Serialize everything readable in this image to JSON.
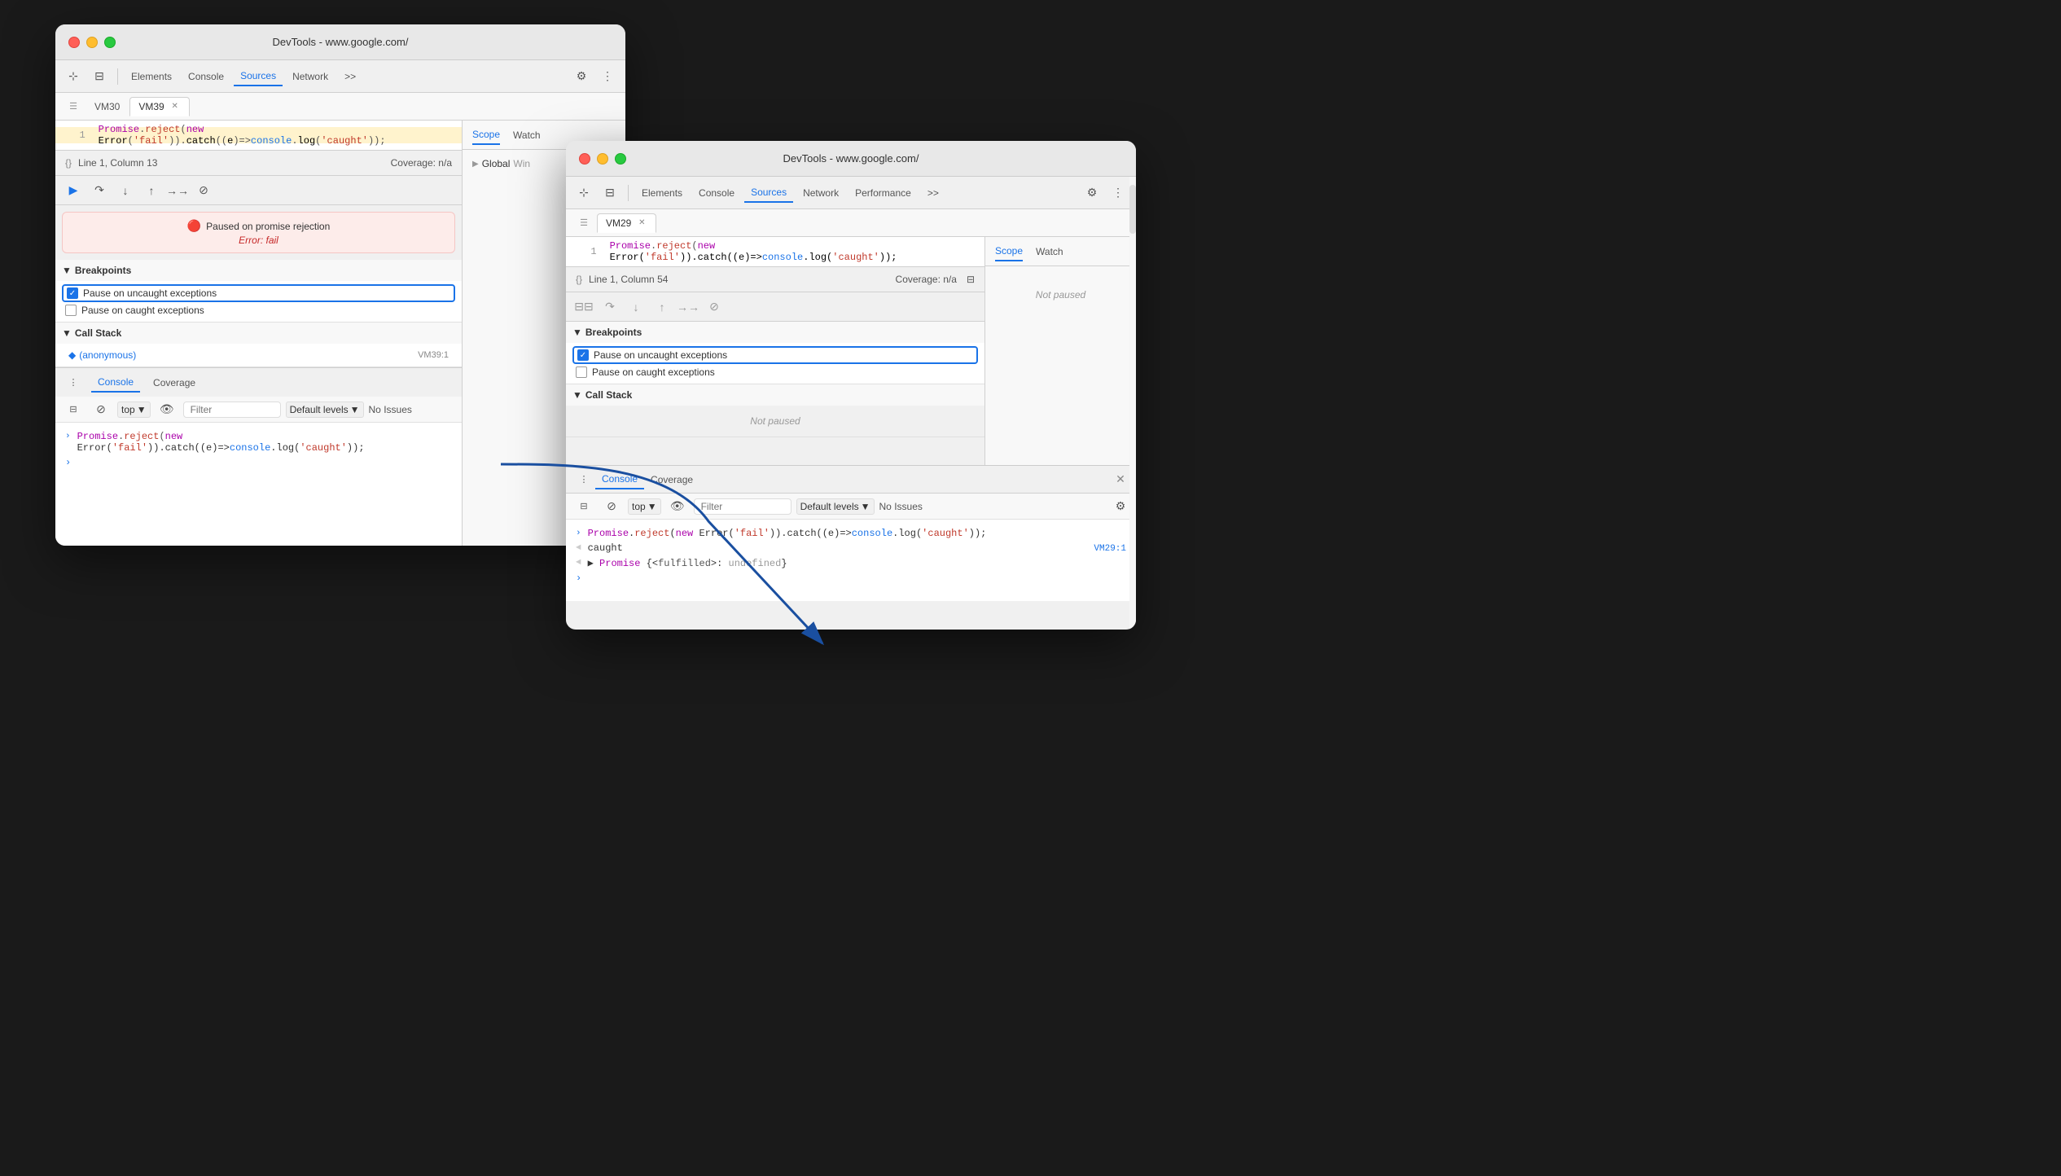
{
  "window1": {
    "title": "DevTools - www.google.com/",
    "tabs": [
      "Elements",
      "Console",
      "Sources",
      "Network",
      ">>"
    ],
    "active_tab": "Sources",
    "file_tabs": [
      "VM30",
      "VM39"
    ],
    "active_file": "VM39",
    "code": {
      "line1": "Promise.reject(new Error('fail')).catch((e)=>console.log('caught'));"
    },
    "status": {
      "position": "Line 1, Column 13",
      "coverage": "Coverage: n/a"
    },
    "paused_message": "Paused on promise rejection",
    "error_message": "Error: fail",
    "breakpoints_header": "Breakpoints",
    "breakpoint1": "Pause on uncaught exceptions",
    "breakpoint2": "Pause on caught exceptions",
    "callstack_header": "Call Stack",
    "callstack_item": "(anonymous)",
    "callstack_location": "VM39:1",
    "console_label": "Console",
    "coverage_label": "Coverage",
    "console_toolbar": {
      "top_label": "top",
      "filter_placeholder": "Filter",
      "levels_label": "Default levels",
      "issues_label": "No Issues"
    },
    "console_line1": "Promise.reject(new Error('fail')).catch((e)=>console.log('caught'));",
    "scope_label": "Scope",
    "watch_label": "Watch",
    "global_label": "Global",
    "win_label": "Win"
  },
  "window2": {
    "title": "DevTools - www.google.com/",
    "tabs": [
      "Elements",
      "Console",
      "Sources",
      "Network",
      "Performance",
      ">>"
    ],
    "active_tab": "Sources",
    "file_tabs": [
      "VM29"
    ],
    "active_file": "VM29",
    "code": {
      "line1": "Promise.reject(new Error('fail')).catch((e)=>console.log('caught'));"
    },
    "status": {
      "position": "Line 1, Column 54",
      "coverage": "Coverage: n/a"
    },
    "breakpoints_header": "Breakpoints",
    "breakpoint1": "Pause on uncaught exceptions",
    "breakpoint2": "Pause on caught exceptions",
    "callstack_header": "Call Stack",
    "not_paused": "Not paused",
    "console_label": "Console",
    "coverage_label": "Coverage",
    "console_toolbar": {
      "top_label": "top",
      "filter_placeholder": "Filter",
      "levels_label": "Default levels",
      "issues_label": "No Issues"
    },
    "console_line1": "Promise.reject(new Error('fail')).catch((e)=>console.log('caught'));",
    "console_line2": "caught",
    "console_line2_location": "VM29:1",
    "console_line3": "◄ ▶ Promise {<fulfilled>: undefined}",
    "scope_label": "Scope",
    "watch_label": "Watch",
    "scope_not_paused": "Not paused"
  },
  "icons": {
    "devtools": "⊞",
    "mobile": "📱",
    "cursor": "⊹",
    "gear": "⚙",
    "more": "⋮",
    "expand": "▶",
    "collapse": "▼",
    "check": "✓",
    "close": "✕",
    "resume": "▶",
    "step_over": "↷",
    "step_into": "↓",
    "step_out": "↑",
    "step": "→",
    "deactivate": "⊘",
    "eye": "👁",
    "format": "{}",
    "panel": "⊟",
    "sidebar": "☰"
  }
}
